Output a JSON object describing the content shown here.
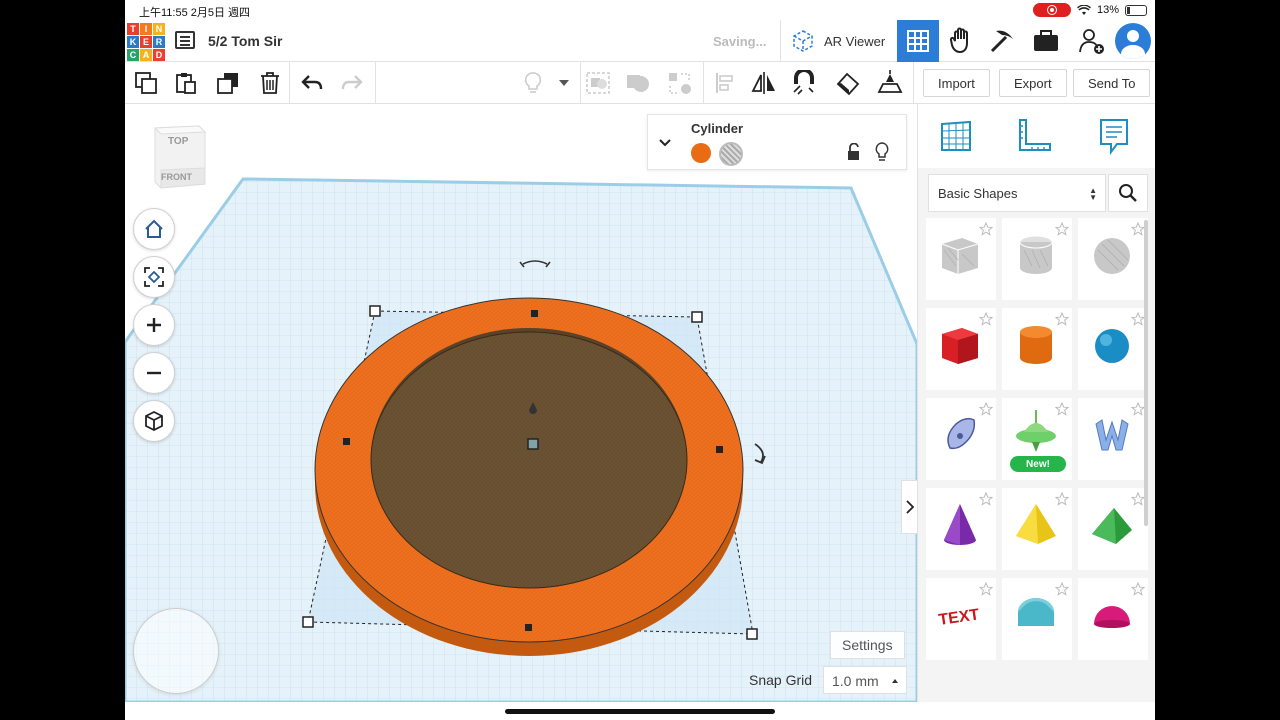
{
  "status_bar": {
    "time": "上午11:55  2月5日 週四",
    "battery": "13%"
  },
  "logo": {
    "letters": [
      "T",
      "I",
      "N",
      "K",
      "E",
      "R",
      "C",
      "A",
      "D"
    ],
    "colors": [
      "#e8402c",
      "#f47a20",
      "#f6b21b",
      "#2a7ac4",
      "#e8402c",
      "#2a7ac4",
      "#2aa26a",
      "#f6b21b",
      "#e8402c"
    ]
  },
  "header": {
    "title": "5/2 Tom Sir",
    "saving": "Saving...",
    "ar_viewer": "AR Viewer",
    "icons": [
      "ar-cube-icon",
      "grid-view-icon",
      "hand-icon",
      "pickaxe-icon",
      "briefcase-icon",
      "add-user-icon",
      "avatar"
    ]
  },
  "toolbar": {
    "import": "Import",
    "export": "Export",
    "send_to": "Send To",
    "icons": [
      "copy-icon",
      "paste-icon",
      "duplicate-icon",
      "delete-icon",
      "undo-icon",
      "redo-icon",
      "light-icon",
      "group-icon",
      "union-icon",
      "ungroup-icon",
      "align-icon",
      "mirror-icon",
      "magnet-icon",
      "ruler-icon",
      "workplane-icon"
    ]
  },
  "viewcube": {
    "top": "TOP",
    "front": "FRONT"
  },
  "inspector": {
    "title": "Cylinder",
    "solid_color": "#e96c14"
  },
  "canvas": {
    "settings": "Settings",
    "snap_label": "Snap Grid",
    "snap_value": "1.0 mm"
  },
  "panel": {
    "library": "Basic Shapes",
    "badge_new": "New!",
    "shapes": [
      "box-hole",
      "cylinder-hole",
      "sphere-hole",
      "box",
      "cylinder",
      "sphere",
      "scribble",
      "spinner",
      "text-shape",
      "cone",
      "pyramid",
      "wedge",
      "text-3d",
      "half-cylinder",
      "dome"
    ]
  }
}
